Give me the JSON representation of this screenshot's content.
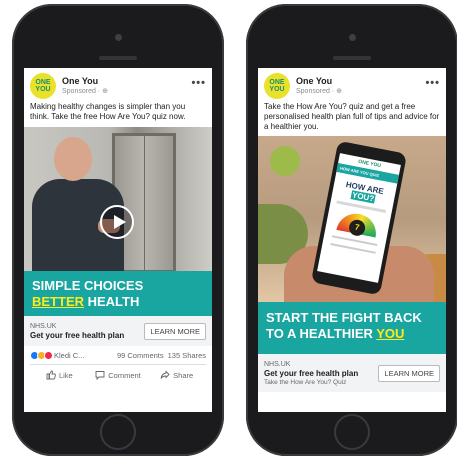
{
  "left_ad": {
    "page_name": "One You",
    "sponsored": "Sponsored · ⊕",
    "logo_line1": "ONE",
    "logo_line2": "YOU",
    "caption": "Making healthy changes is simpler than you think. Take the free How Are You? quiz now.",
    "banner_line1": "SIMPLE CHOICES",
    "banner_word_yellow": "BETTER",
    "banner_word_white": " HEALTH",
    "domain": "NHS.UK",
    "headline": "Get your free health plan",
    "cta": "LEARN MORE",
    "reaction_name": "Kledi C...",
    "comments": "99 Comments",
    "shares": "135 Shares",
    "like": "Like",
    "comment": "Comment",
    "share": "Share"
  },
  "right_ad": {
    "page_name": "One You",
    "sponsored": "Sponsored · ⊕",
    "logo_line1": "ONE",
    "logo_line2": "YOU",
    "caption": "Take the How Are You? quiz and get a free personalised health plan full of tips and advice for a healthier you.",
    "device_brand": "ONE YOU",
    "device_bar": "HOW ARE YOU QUIZ",
    "device_title_a": "HOW ARE ",
    "device_title_b": "YOU?",
    "gauge_value": "7",
    "banner_line1": "START THE FIGHT BACK",
    "banner_line2a": "TO A HEALTHIER ",
    "banner_line2b": "YOU",
    "domain": "NHS.UK",
    "headline": "Get your free health plan",
    "sub": "Take the How Are You? Quiz",
    "cta": "LEARN MORE"
  },
  "more_glyph": "•••",
  "colors": {
    "teal": "#19a5a0",
    "yellow": "#ffeb1a",
    "logo_yellow": "#e9e12a",
    "facebook_blue": "#1877f2"
  }
}
